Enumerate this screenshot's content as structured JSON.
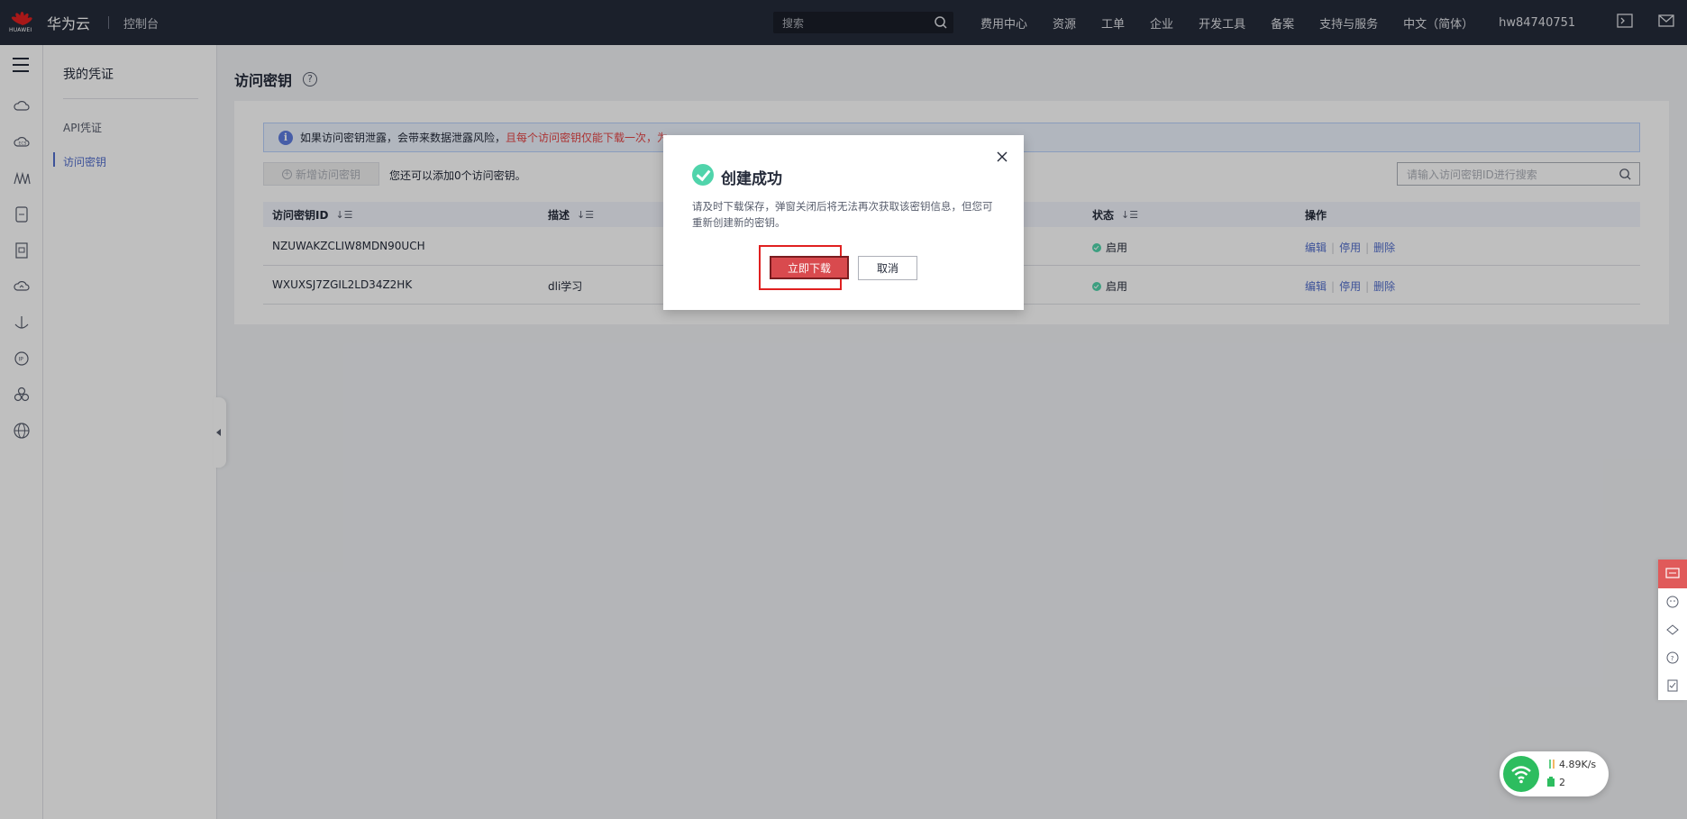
{
  "topbar": {
    "brand": "华为云",
    "brand_sub": "HUAWEI",
    "console": "控制台",
    "search_placeholder": "搜索",
    "nav": [
      "费用中心",
      "资源",
      "工单",
      "企业",
      "开发工具",
      "备案",
      "支持与服务",
      "中文（简体）",
      "hw84740751"
    ]
  },
  "sidemenu": {
    "title": "我的凭证",
    "items": [
      "API凭证",
      "访问密钥"
    ]
  },
  "page": {
    "title": "访问密钥",
    "help": "?"
  },
  "alert": {
    "text": "如果访问密钥泄露，会带来数据泄露风险，",
    "red_text": "且每个访问密钥仅能下载一次，为"
  },
  "toolbar": {
    "add_label": "新增访问密钥",
    "add_tip": "您还可以添加0个访问密钥。",
    "search_placeholder": "请输入访问密钥ID进行搜索"
  },
  "table": {
    "headers": [
      "访问密钥ID",
      "描述",
      "状态",
      "操作"
    ],
    "rows": [
      {
        "id": "NZUWAKZCLIW8MDN90UCH",
        "desc": "",
        "status": "启用",
        "actions": [
          "编辑",
          "停用",
          "删除"
        ]
      },
      {
        "id": "WXUXSJ7ZGIL2LD34Z2HK",
        "desc": "dli学习",
        "status": "启用",
        "actions": [
          "编辑",
          "停用",
          "删除"
        ]
      }
    ]
  },
  "dialog": {
    "title": "创建成功",
    "body": "请及时下载保存，弹窗关闭后将无法再次获取该密钥信息，但您可重新创建新的密钥。",
    "primary": "立即下载",
    "cancel": "取消"
  },
  "network": {
    "speed": "4.89K/s",
    "count": "2"
  },
  "colors": {
    "accent": "#526ecc",
    "danger": "#e54545",
    "success": "#50d4ab",
    "topbar": "#252b3a"
  }
}
